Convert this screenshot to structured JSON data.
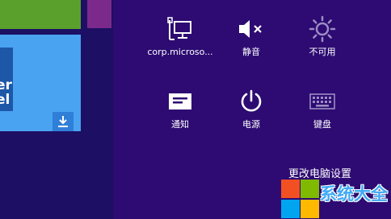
{
  "start_screen": {
    "tile_text": "er\nel"
  },
  "settings_panel": {
    "quick_settings": [
      {
        "id": "network",
        "label": "corp.microso...",
        "icon": "network-icon"
      },
      {
        "id": "volume",
        "label": "静音",
        "icon": "volume-mute-icon"
      },
      {
        "id": "brightness",
        "label": "不可用",
        "icon": "brightness-icon"
      },
      {
        "id": "notifications",
        "label": "通知",
        "icon": "notifications-icon"
      },
      {
        "id": "power",
        "label": "电源",
        "icon": "power-icon"
      },
      {
        "id": "keyboard",
        "label": "键盘",
        "icon": "keyboard-icon"
      }
    ],
    "change_pc_settings": "更改电脑设置"
  },
  "watermark": {
    "text": "系统大全",
    "colors": [
      "#f25022",
      "#7fba00",
      "#00a4ef",
      "#ffb900"
    ]
  },
  "colors": {
    "panel_bg": "#2d0b72",
    "start_bg": "#1d0f63",
    "tile_blue": "#4aa3f0",
    "tile_green": "#5aa02c",
    "tile_purple": "#7b2a8c"
  }
}
